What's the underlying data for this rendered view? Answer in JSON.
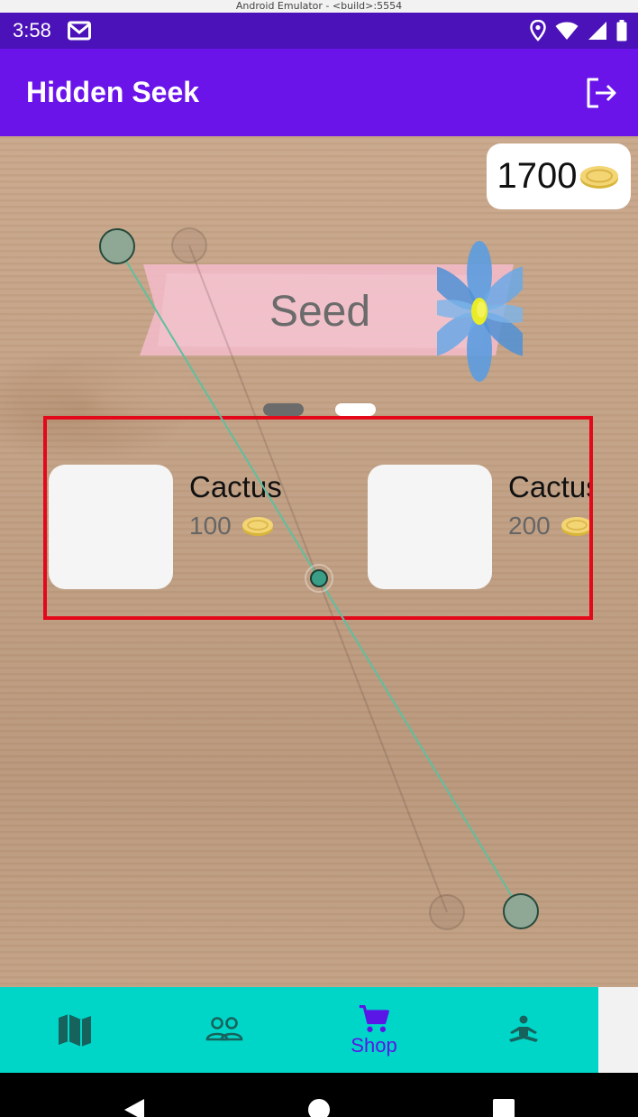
{
  "emulator_title": "Android Emulator - <build>:5554",
  "status_bar": {
    "time": "3:58"
  },
  "app_bar": {
    "title": "Hidden Seek"
  },
  "wallet": {
    "coins": "1700"
  },
  "banner": {
    "title": "Seed"
  },
  "pager": {
    "pages": 2,
    "active_index": 0
  },
  "items": [
    {
      "name": "Cactus",
      "price": "100"
    },
    {
      "name": "Cactus",
      "price": "200"
    }
  ],
  "bottom_nav": {
    "items": [
      {
        "icon": "map-icon",
        "label": ""
      },
      {
        "icon": "friends-icon",
        "label": ""
      },
      {
        "icon": "cart-icon",
        "label": "Shop",
        "active": true
      },
      {
        "icon": "meditation-icon",
        "label": ""
      }
    ]
  },
  "colors": {
    "status_bar": "#4a12b8",
    "app_bar": "#6a14ea",
    "bottom_nav": "#00d6c8",
    "active_nav": "#5a16e6",
    "highlight": "#e3091b"
  }
}
